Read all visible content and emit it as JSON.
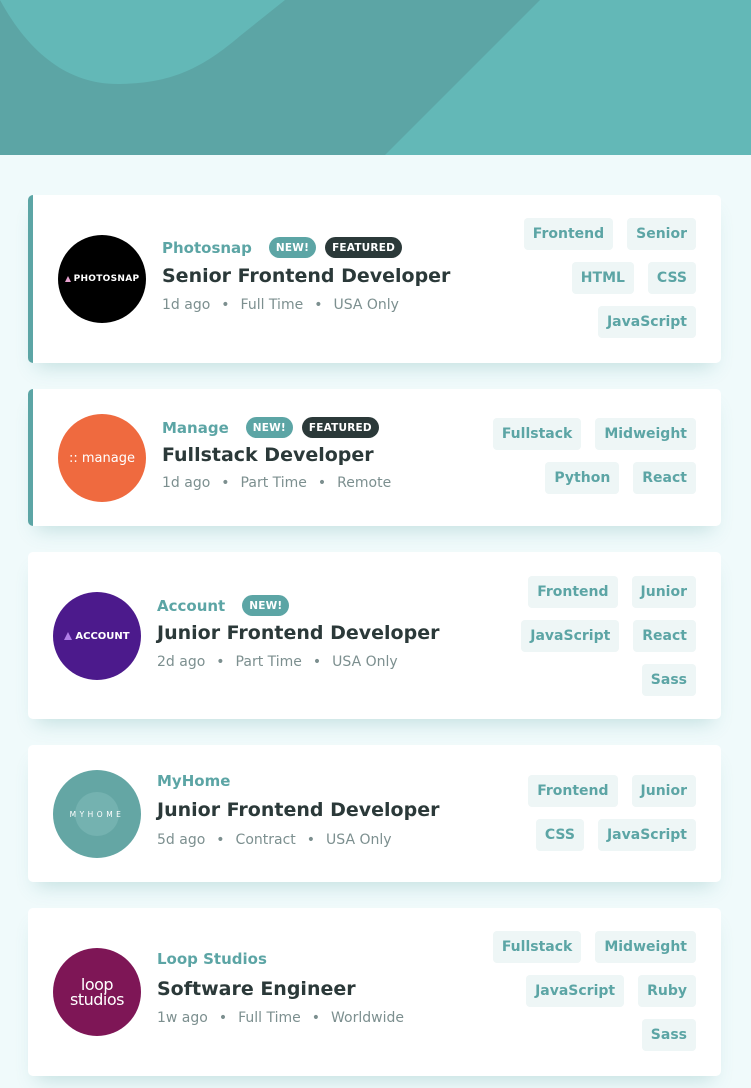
{
  "colors": {
    "header": "#5ca5a5",
    "accent": "#5ca5a5",
    "page_bg": "#f0fafb",
    "card_bg": "#ffffff",
    "tag_bg": "#eef6f6",
    "featured_badge": "#2b3939",
    "heading": "#2b3939",
    "meta": "#7c8f8f"
  },
  "jobs": [
    {
      "company": "Photosnap",
      "logo_text": "PHOTOSNAP",
      "logo_color": "#000000",
      "new_label": "NEW!",
      "featured_label": "FEATURED",
      "position": "Senior Frontend Developer",
      "posted": "1d ago",
      "contract": "Full Time",
      "location": "USA Only",
      "separator": "•",
      "tag_rows": [
        [
          "Frontend",
          "Senior"
        ],
        [
          "HTML",
          "CSS"
        ],
        [
          "JavaScript"
        ]
      ]
    },
    {
      "company": "Manage",
      "logo_text": ":: manage",
      "logo_color": "#ef6a3f",
      "new_label": "NEW!",
      "featured_label": "FEATURED",
      "position": "Fullstack Developer",
      "posted": "1d ago",
      "contract": "Part Time",
      "location": "Remote",
      "separator": "•",
      "tag_rows": [
        [
          "Fullstack",
          "Midweight"
        ],
        [
          "Python",
          "React"
        ]
      ]
    },
    {
      "company": "Account",
      "logo_text": "ACCOUNT",
      "logo_color": "#4c1a8c",
      "new_label": "NEW!",
      "position": "Junior Frontend Developer",
      "posted": "2d ago",
      "contract": "Part Time",
      "location": "USA Only",
      "separator": "•",
      "tag_rows": [
        [
          "Frontend",
          "Junior"
        ],
        [
          "JavaScript",
          "React"
        ],
        [
          "Sass"
        ]
      ]
    },
    {
      "company": "MyHome",
      "logo_text": "MYHOME",
      "logo_color": "#64a6a4",
      "position": "Junior Frontend Developer",
      "posted": "5d ago",
      "contract": "Contract",
      "location": "USA Only",
      "separator": "•",
      "tag_rows": [
        [
          "Frontend",
          "Junior"
        ],
        [
          "CSS",
          "JavaScript"
        ]
      ]
    },
    {
      "company": "Loop Studios",
      "logo_text_1": "loop",
      "logo_text_2": "studios",
      "logo_color": "#7e1656",
      "position": "Software Engineer",
      "posted": "1w ago",
      "contract": "Full Time",
      "location": "Worldwide",
      "separator": "•",
      "tag_rows": [
        [
          "Fullstack",
          "Midweight"
        ],
        [
          "JavaScript",
          "Ruby"
        ],
        [
          "Sass"
        ]
      ]
    }
  ]
}
